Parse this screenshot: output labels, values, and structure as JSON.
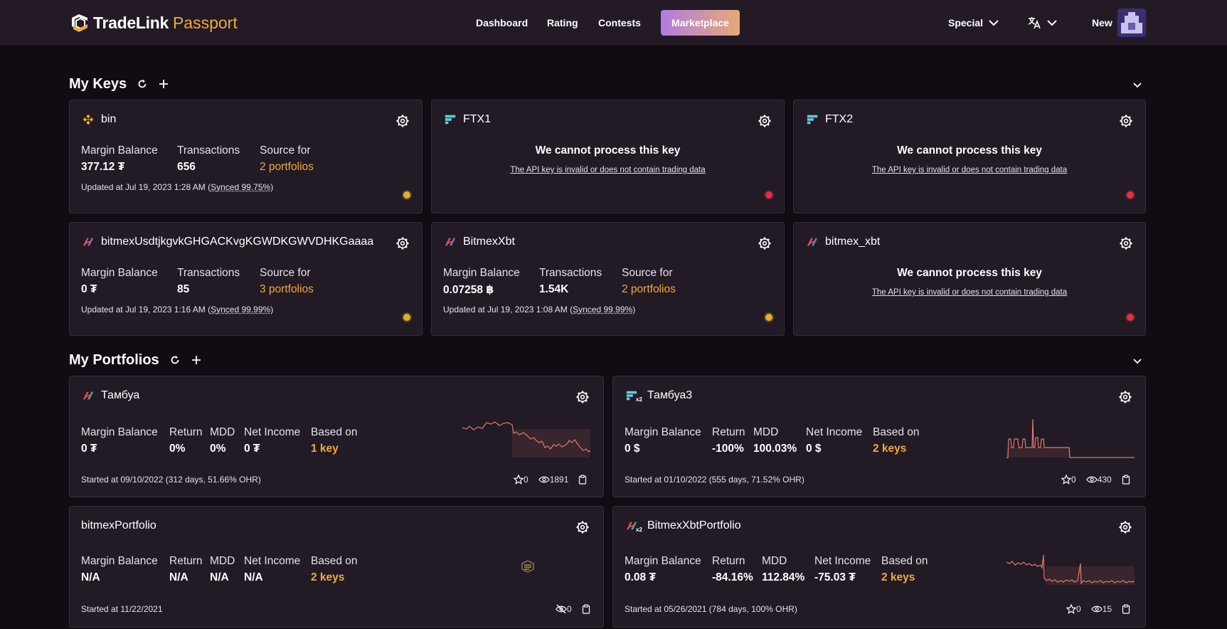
{
  "header": {
    "brand": "TradeLink",
    "brand_suffix": "Passport",
    "nav": [
      "Dashboard",
      "Rating",
      "Contests"
    ],
    "marketplace": "Marketplace",
    "special": "Special",
    "new_label": "New"
  },
  "keys_section": {
    "title": "My Keys"
  },
  "portfolios_section": {
    "title": "My Portfolios"
  },
  "labels": {
    "margin_balance": "Margin Balance",
    "transactions": "Transactions",
    "source_for": "Source for",
    "return": "Return",
    "mdd": "MDD",
    "net_income": "Net Income",
    "based_on": "Based on",
    "cannot_process": "We cannot process this key",
    "invalid_key": "The API key is invalid or does not contain trading data"
  },
  "keys": [
    {
      "name": "bin",
      "exchange_icon": "binance-icon",
      "margin_balance": "377.12 ₮",
      "transactions": "656",
      "source_for": "2 portfolios",
      "updated": "Updated at Jul 19, 2023 1:28 AM (",
      "synced": "Synced 99.75%",
      "updated_end": ")",
      "status": "ok"
    },
    {
      "name": "FTX1",
      "exchange_icon": "ftx-icon",
      "status": "error"
    },
    {
      "name": "FTX2",
      "exchange_icon": "ftx-icon",
      "status": "error"
    },
    {
      "name": "bitmexUsdtjkgvkGHGACKvgKGWDKGWVDHKGaaaa",
      "exchange_icon": "bitmex-icon",
      "margin_balance": "0 ₮",
      "transactions": "85",
      "source_for": "3 portfolios",
      "updated": "Updated at Jul 19, 2023 1:16 AM (",
      "synced": "Synced 99.99%",
      "updated_end": ")",
      "status": "ok"
    },
    {
      "name": "BitmexXbt",
      "exchange_icon": "bitmex-icon",
      "margin_balance": "0.07258 ฿",
      "transactions": "1.54K",
      "source_for": "2 portfolios",
      "updated": "Updated at Jul 19, 2023 1:08 AM (",
      "synced": "Synced 99.99%",
      "updated_end": ")",
      "status": "ok"
    },
    {
      "name": "bitmex_xbt",
      "exchange_icon": "bitmex-icon",
      "status": "error"
    }
  ],
  "portfolios": [
    {
      "name": "Тамбуа",
      "exchange_icon": "bitmex-icon",
      "margin_balance": "0 ₮",
      "return": "0%",
      "mdd": "0%",
      "net_income": "0 ₮",
      "based_on": "1 key",
      "started": "Started at 09/10/2022 (312 days, 51.66% OHR)",
      "stars": "0",
      "views": "1891"
    },
    {
      "name": "Тамбуа3",
      "exchange_icon": "ftx-icon",
      "badge": "x2",
      "margin_balance": "0 $",
      "return": "-100%",
      "mdd": "100.03%",
      "net_income": "0 $",
      "based_on": "2 keys",
      "started": "Started at 01/10/2022 (555 days, 71.52% OHR)",
      "stars": "0",
      "views": "430"
    },
    {
      "name": "bitmexPortfolio",
      "margin_balance": "N/A",
      "return": "N/A",
      "mdd": "N/A",
      "net_income": "N/A",
      "based_on": "2 keys",
      "started": "Started at 11/22/2021",
      "stars": "0"
    },
    {
      "name": "BitmexXbtPortfolio",
      "exchange_icon": "bitmex-icon",
      "badge": "x2",
      "margin_balance": "0.08 ₮",
      "return": "-84.16%",
      "mdd": "112.84%",
      "net_income": "-75.03 ₮",
      "based_on": "2 keys",
      "started": "Started at 05/26/2021 (784 days, 100% OHR)",
      "stars": "0",
      "views": "15"
    }
  ],
  "colors": {
    "accent": "#f2a93b",
    "card_bg": "#221a25",
    "page_bg": "#120b13",
    "ok": "#e2b025",
    "error": "#e0303f",
    "spark": "#e07a6e"
  }
}
